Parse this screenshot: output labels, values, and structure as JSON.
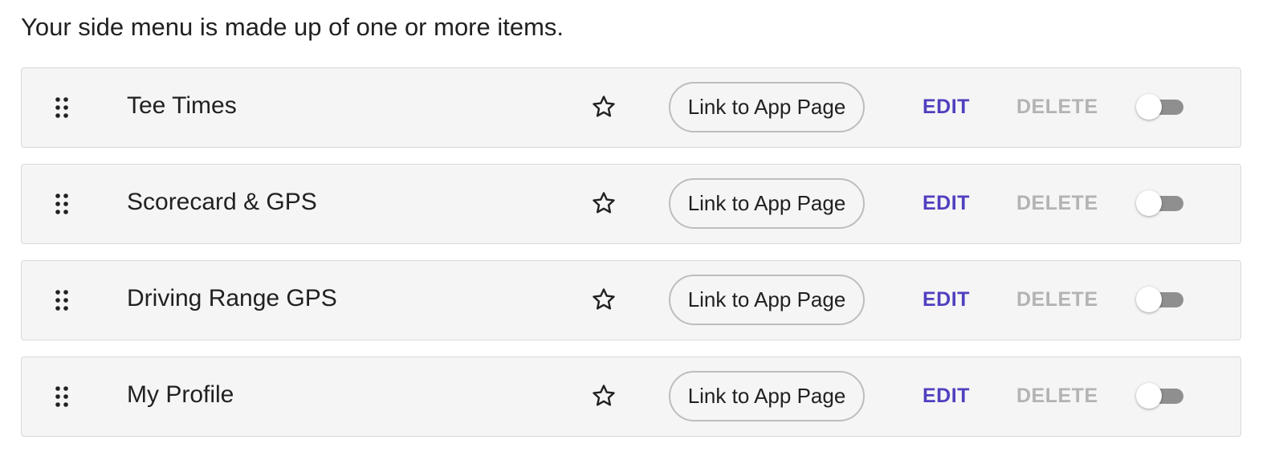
{
  "intro_text": "Your side menu is made up of one or more items.",
  "colors": {
    "edit": "#5040c0",
    "delete_disabled": "#b3b3b3",
    "row_background": "#f5f5f5",
    "toggle_off": "#8f8f8f"
  },
  "icons": {
    "drag": "drag-handle-icon",
    "favorite": "star-outline-icon"
  },
  "menu_items": [
    {
      "label": "Tee Times",
      "link_button": "Link to App Page",
      "edit_label": "EDIT",
      "delete_label": "DELETE",
      "enabled": false
    },
    {
      "label": "Scorecard & GPS",
      "link_button": "Link to App Page",
      "edit_label": "EDIT",
      "delete_label": "DELETE",
      "enabled": false
    },
    {
      "label": "Driving Range GPS",
      "link_button": "Link to App Page",
      "edit_label": "EDIT",
      "delete_label": "DELETE",
      "enabled": false
    },
    {
      "label": "My Profile",
      "link_button": "Link to App Page",
      "edit_label": "EDIT",
      "delete_label": "DELETE",
      "enabled": false
    }
  ]
}
